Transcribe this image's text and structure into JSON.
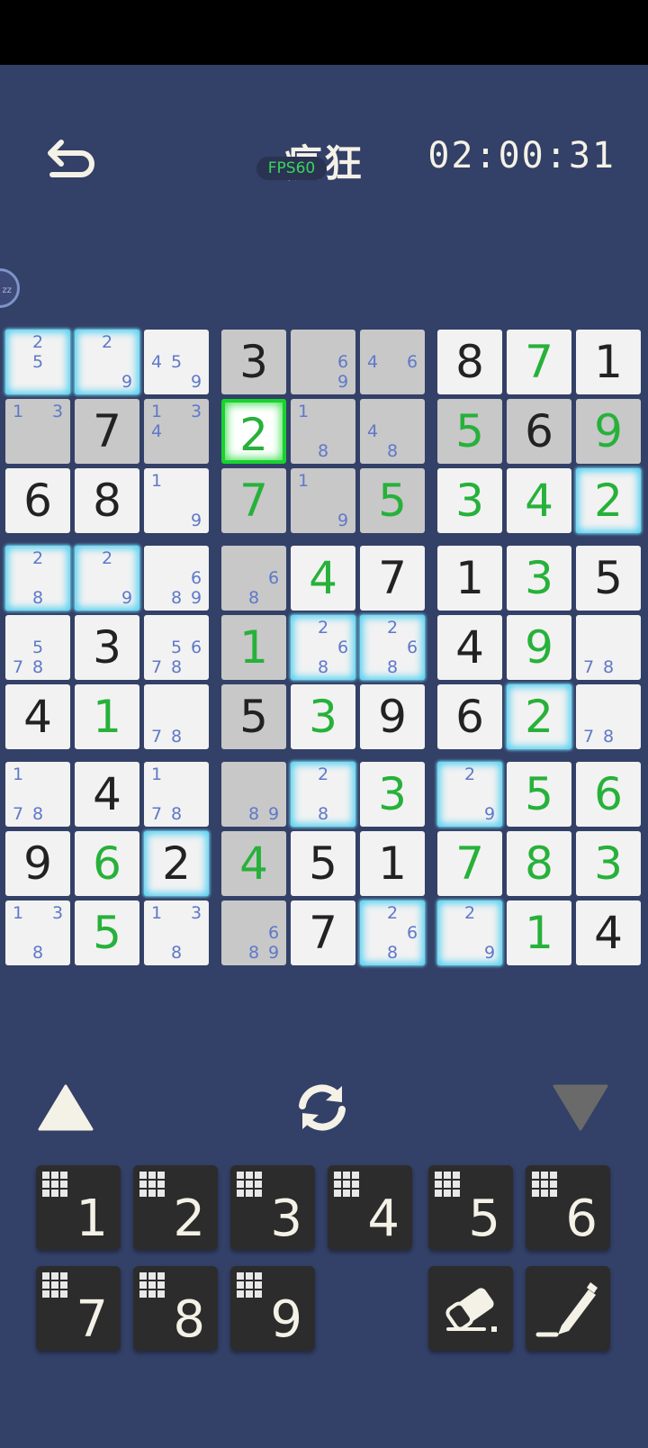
{
  "header": {
    "title": "疯狂",
    "fps": "FPS60",
    "timer": "02:00:31",
    "side_label": "zz"
  },
  "colors": {
    "background": "#334067",
    "given": "#222222",
    "entered": "#27b13a",
    "note": "#5f79c9",
    "highlight": "#4fd0f2",
    "selected": "#19d22d"
  },
  "board": {
    "rows": [
      [
        {
          "n": [
            "2",
            "5"
          ]
        },
        {
          "n": [
            "2",
            "9"
          ]
        },
        {
          "n": [
            "4",
            "5",
            "9"
          ]
        },
        {
          "v": "3"
        },
        {
          "n": [
            "6",
            "9"
          ]
        },
        {
          "n": [
            "4",
            "6"
          ]
        },
        {
          "v": "8"
        },
        {
          "v": "7",
          "g": true
        },
        {
          "v": "1"
        }
      ],
      [
        {
          "n": [
            "1",
            "3"
          ]
        },
        {
          "v": "7"
        },
        {
          "n": [
            "1",
            "3",
            "4"
          ]
        },
        {
          "v": "2",
          "g": true
        },
        {
          "n": [
            "1",
            "8"
          ]
        },
        {
          "n": [
            "4",
            "8"
          ]
        },
        {
          "v": "5",
          "g": true
        },
        {
          "v": "6"
        },
        {
          "v": "9",
          "g": true
        }
      ],
      [
        {
          "v": "6"
        },
        {
          "v": "8"
        },
        {
          "n": [
            "1",
            "9"
          ]
        },
        {
          "v": "7",
          "g": true
        },
        {
          "n": [
            "1",
            "9"
          ]
        },
        {
          "v": "5",
          "g": true
        },
        {
          "v": "3",
          "g": true
        },
        {
          "v": "4",
          "g": true
        },
        {
          "v": "2",
          "g": true
        }
      ],
      [
        {
          "n": [
            "2",
            "8"
          ]
        },
        {
          "n": [
            "2",
            "9"
          ]
        },
        {
          "n": [
            "6",
            "8",
            "9"
          ]
        },
        {
          "n": [
            "6",
            "8"
          ]
        },
        {
          "v": "4",
          "g": true
        },
        {
          "v": "7"
        },
        {
          "v": "1"
        },
        {
          "v": "3",
          "g": true
        },
        {
          "v": "5"
        }
      ],
      [
        {
          "n": [
            "5",
            "7",
            "8"
          ]
        },
        {
          "v": "3"
        },
        {
          "n": [
            "5",
            "6",
            "7",
            "8"
          ]
        },
        {
          "v": "1",
          "g": true
        },
        {
          "n": [
            "2",
            "6",
            "8"
          ]
        },
        {
          "n": [
            "2",
            "6",
            "8"
          ]
        },
        {
          "v": "4"
        },
        {
          "v": "9",
          "g": true
        },
        {
          "n": [
            "7",
            "8"
          ]
        }
      ],
      [
        {
          "v": "4"
        },
        {
          "v": "1",
          "g": true
        },
        {
          "n": [
            "7",
            "8"
          ]
        },
        {
          "v": "5"
        },
        {
          "v": "3",
          "g": true
        },
        {
          "v": "9"
        },
        {
          "v": "6"
        },
        {
          "v": "2",
          "g": true
        },
        {
          "n": [
            "7",
            "8"
          ]
        }
      ],
      [
        {
          "n": [
            "1",
            "7",
            "8"
          ]
        },
        {
          "v": "4"
        },
        {
          "n": [
            "1",
            "7",
            "8"
          ]
        },
        {
          "n": [
            "8",
            "9"
          ]
        },
        {
          "n": [
            "2",
            "8"
          ]
        },
        {
          "v": "3",
          "g": true
        },
        {
          "n": [
            "2",
            "9"
          ]
        },
        {
          "v": "5",
          "g": true
        },
        {
          "v": "6",
          "g": true
        }
      ],
      [
        {
          "v": "9"
        },
        {
          "v": "6",
          "g": true
        },
        {
          "v": "2"
        },
        {
          "v": "4",
          "g": true
        },
        {
          "v": "5"
        },
        {
          "v": "1"
        },
        {
          "v": "7",
          "g": true
        },
        {
          "v": "8",
          "g": true
        },
        {
          "v": "3",
          "g": true
        }
      ],
      [
        {
          "n": [
            "1",
            "3",
            "8"
          ]
        },
        {
          "v": "5",
          "g": true
        },
        {
          "n": [
            "1",
            "3",
            "8"
          ]
        },
        {
          "n": [
            "6",
            "8",
            "9"
          ]
        },
        {
          "v": "7"
        },
        {
          "n": [
            "2",
            "6",
            "8"
          ]
        },
        {
          "n": [
            "2",
            "9"
          ]
        },
        {
          "v": "1",
          "g": true
        },
        {
          "v": "4"
        }
      ]
    ]
  },
  "controls": {
    "numbers": [
      "1",
      "2",
      "3",
      "4",
      "5",
      "6",
      "7",
      "8",
      "9"
    ],
    "icons": {
      "back": "undo-arrow-icon",
      "up": "triangle-up-icon",
      "refresh": "refresh-icon",
      "down": "triangle-down-icon",
      "erase": "eraser-icon",
      "pencil": "pencil-icon"
    }
  }
}
